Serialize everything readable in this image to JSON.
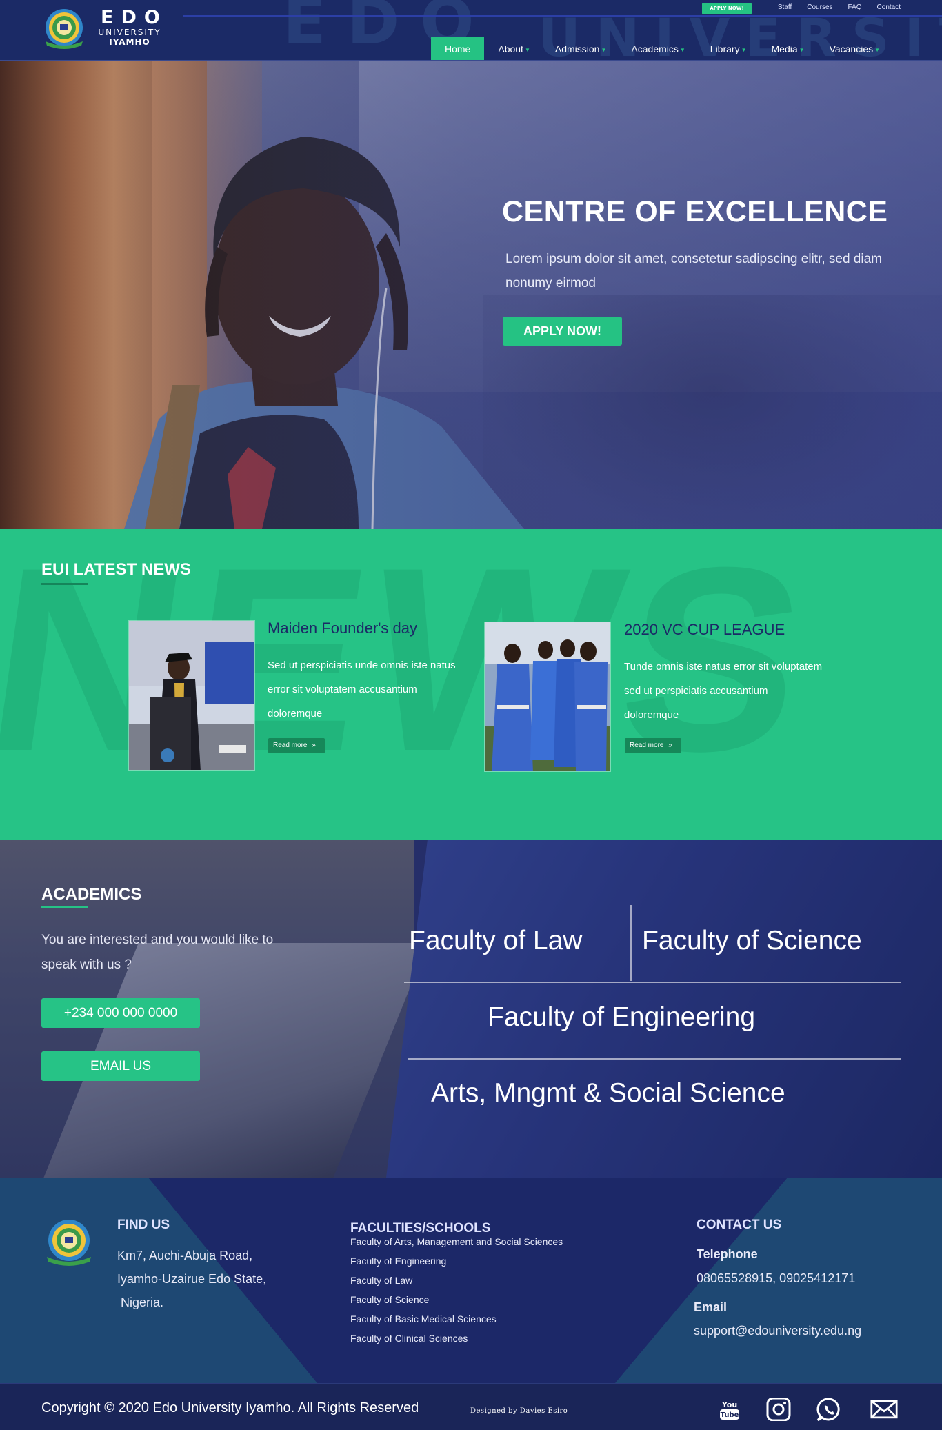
{
  "header": {
    "logo": {
      "edo": "EDO",
      "university": "UNIVERSITY",
      "iyamho": "IYAMHO"
    },
    "watermark": [
      "EDO",
      "UNIVERSITY"
    ],
    "top_apply": "APPLY NOW!",
    "top_links": [
      "Staff",
      "Courses",
      "FAQ",
      "Contact"
    ],
    "nav": [
      {
        "label": "Home",
        "active": true,
        "dropdown": false
      },
      {
        "label": "About",
        "active": false,
        "dropdown": true
      },
      {
        "label": "Admission",
        "active": false,
        "dropdown": true
      },
      {
        "label": "Academics",
        "active": false,
        "dropdown": true
      },
      {
        "label": "Library",
        "active": false,
        "dropdown": true
      },
      {
        "label": "Media",
        "active": false,
        "dropdown": true
      },
      {
        "label": "Vacancies",
        "active": false,
        "dropdown": true
      }
    ]
  },
  "hero": {
    "title": "CENTRE OF EXCELLENCE",
    "text": "Lorem ipsum dolor sit amet, consetetur sadipscing elitr, sed diam nonumy eirmod",
    "button": "APPLY NOW!"
  },
  "news": {
    "watermark": "NEWS",
    "title": "EUI LATEST NEWS",
    "items": [
      {
        "heading": "Maiden Founder's day",
        "body": "Sed ut perspiciatis unde omnis iste natus error sit voluptatem accusantium doloremque",
        "read_more": "Read more"
      },
      {
        "heading": "2020 VC CUP LEAGUE",
        "body": "Tunde omnis iste natus error sit voluptatem sed ut perspiciatis accusantium doloremque",
        "read_more": "Read more"
      }
    ]
  },
  "academics": {
    "title": "ACADEMICS",
    "text": "You are interested and you would like to speak with us ?",
    "phone": "+234 000 000 0000",
    "email_button": "EMAIL US",
    "faculties": {
      "law": "Faculty of Law",
      "science": "Faculty of Science",
      "engineering": "Faculty of Engineering",
      "arts": "Arts, Mngmt & Social Science"
    }
  },
  "footer": {
    "find_us": {
      "title": "FIND US",
      "address": [
        "Km7, Auchi-Abuja Road,",
        "Iyamho-Uzairue Edo State,",
        " Nigeria."
      ]
    },
    "faculties": {
      "title": "FACULTIES/SCHOOLS",
      "items": [
        "Faculty of Arts, Management and Social Sciences",
        "Faculty of Engineering",
        "Faculty of Law",
        "Faculty of Science",
        "Faculty of Basic Medical Sciences",
        "Faculty of Clinical Sciences"
      ]
    },
    "contact": {
      "title": "CONTACT US",
      "telephone_label": "Telephone",
      "telephone": "08065528915, 09025412171",
      "email_label": "Email",
      "email": "support@edouniversity.edu.ng"
    }
  },
  "bottom": {
    "copyright": "Copyright © 2020 Edo University Iyamho. All Rights Reserved",
    "designer": "Designed by Davies Esiro",
    "social": [
      "youtube-icon",
      "instagram-icon",
      "whatsapp-icon",
      "mail-icon"
    ],
    "youtube_text": [
      "You",
      "Tube"
    ]
  },
  "colors": {
    "navy": "#1b2a66",
    "green": "#26c386",
    "dark_green": "#168859"
  }
}
